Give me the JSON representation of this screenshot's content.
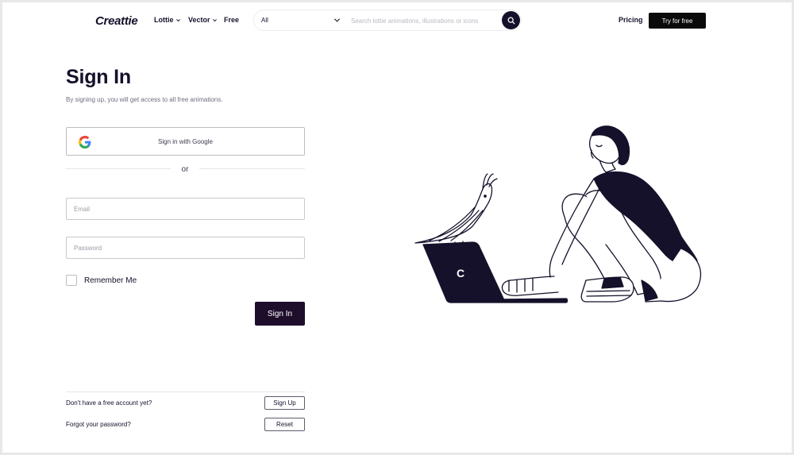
{
  "header": {
    "logo": "Creattie",
    "nav": [
      {
        "label": "Lottie",
        "has_dropdown": true
      },
      {
        "label": "Vector",
        "has_dropdown": true
      },
      {
        "label": "Free",
        "has_dropdown": false
      }
    ],
    "search": {
      "category": "All",
      "placeholder": "Search lottie animations, illustrations or icons",
      "value": ""
    },
    "pricing": "Pricing",
    "try_button": "Try for free"
  },
  "form": {
    "title": "Sign In",
    "subtitle": "By signing up, you will get access to all free animations.",
    "google_button": "Sign in with Google",
    "or": "or",
    "email_placeholder": "Email",
    "password_placeholder": "Password",
    "remember_me": "Remember Me",
    "remember_checked": false,
    "submit": "Sign In"
  },
  "footer": {
    "no_account": "Don't have a free account yet?",
    "signup_button": "Sign Up",
    "forgot": "Forgot your password?",
    "reset_button": "Reset"
  },
  "colors": {
    "brand_dark": "#15112b",
    "primary_button": "#1e0e2c",
    "google_blue": "#4285F4",
    "google_red": "#EA4335",
    "google_yellow": "#FBBC05",
    "google_green": "#34A853"
  },
  "icons": {
    "nav_dropdown": "chevron-down-icon",
    "search_category": "chevron-down-icon",
    "search_button": "search-icon",
    "google": "google-icon"
  }
}
